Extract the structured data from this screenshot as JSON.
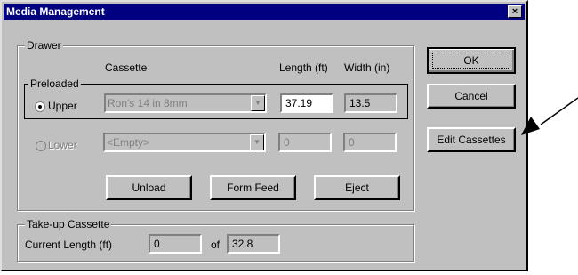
{
  "window": {
    "title": "Media Management",
    "close_label": "×"
  },
  "drawer": {
    "legend": "Drawer",
    "columns": {
      "cassette": "Cassette",
      "length": "Length (ft)",
      "width": "Width (in)"
    },
    "preloaded_label": "Preloaded",
    "upper": {
      "label": "Upper",
      "cassette": "Ron's 14 in 8mm",
      "length": "37.19",
      "width": "13.5",
      "selected": true
    },
    "lower": {
      "label": "Lower",
      "cassette": "<Empty>",
      "length": "0",
      "width": "0",
      "selected": false
    },
    "buttons": {
      "unload": "Unload",
      "form_feed": "Form Feed",
      "eject": "Eject"
    }
  },
  "takeup": {
    "legend": "Take-up Cassette",
    "current_length_label": "Current Length (ft)",
    "current_length": "0",
    "of_label": "of",
    "max_length": "32.8"
  },
  "side_buttons": {
    "ok": "OK",
    "cancel": "Cancel",
    "edit_cassettes": "Edit Cassettes"
  },
  "icons": {
    "close": "close-icon",
    "dropdown": "chevron-down-icon",
    "pointer": "arrow-annotation-icon"
  }
}
